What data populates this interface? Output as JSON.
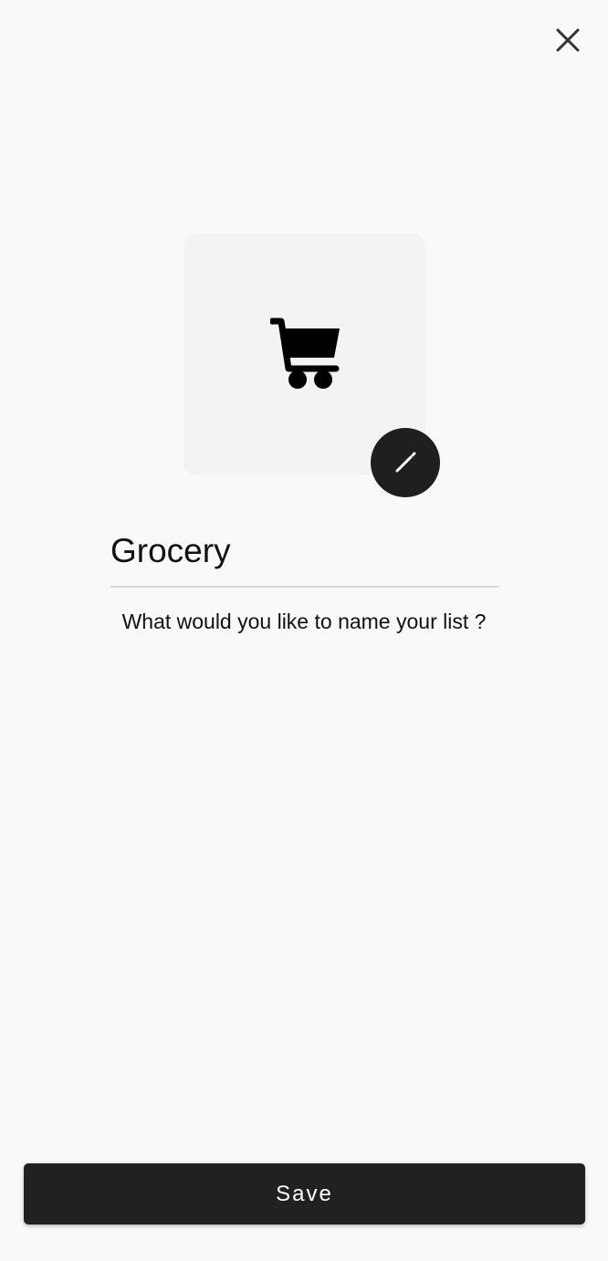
{
  "header": {
    "close_icon": "close-icon"
  },
  "list_icon": {
    "icon": "shopping-cart-icon",
    "edit_icon": "pencil-icon"
  },
  "form": {
    "name_value": "Grocery",
    "helper_text": "What would you like to name your list ?"
  },
  "actions": {
    "save_label": "Save"
  },
  "colors": {
    "background": "#f9f9f9",
    "tile": "#f3f3f3",
    "primary": "#212121",
    "underline": "#d9d9d9"
  }
}
